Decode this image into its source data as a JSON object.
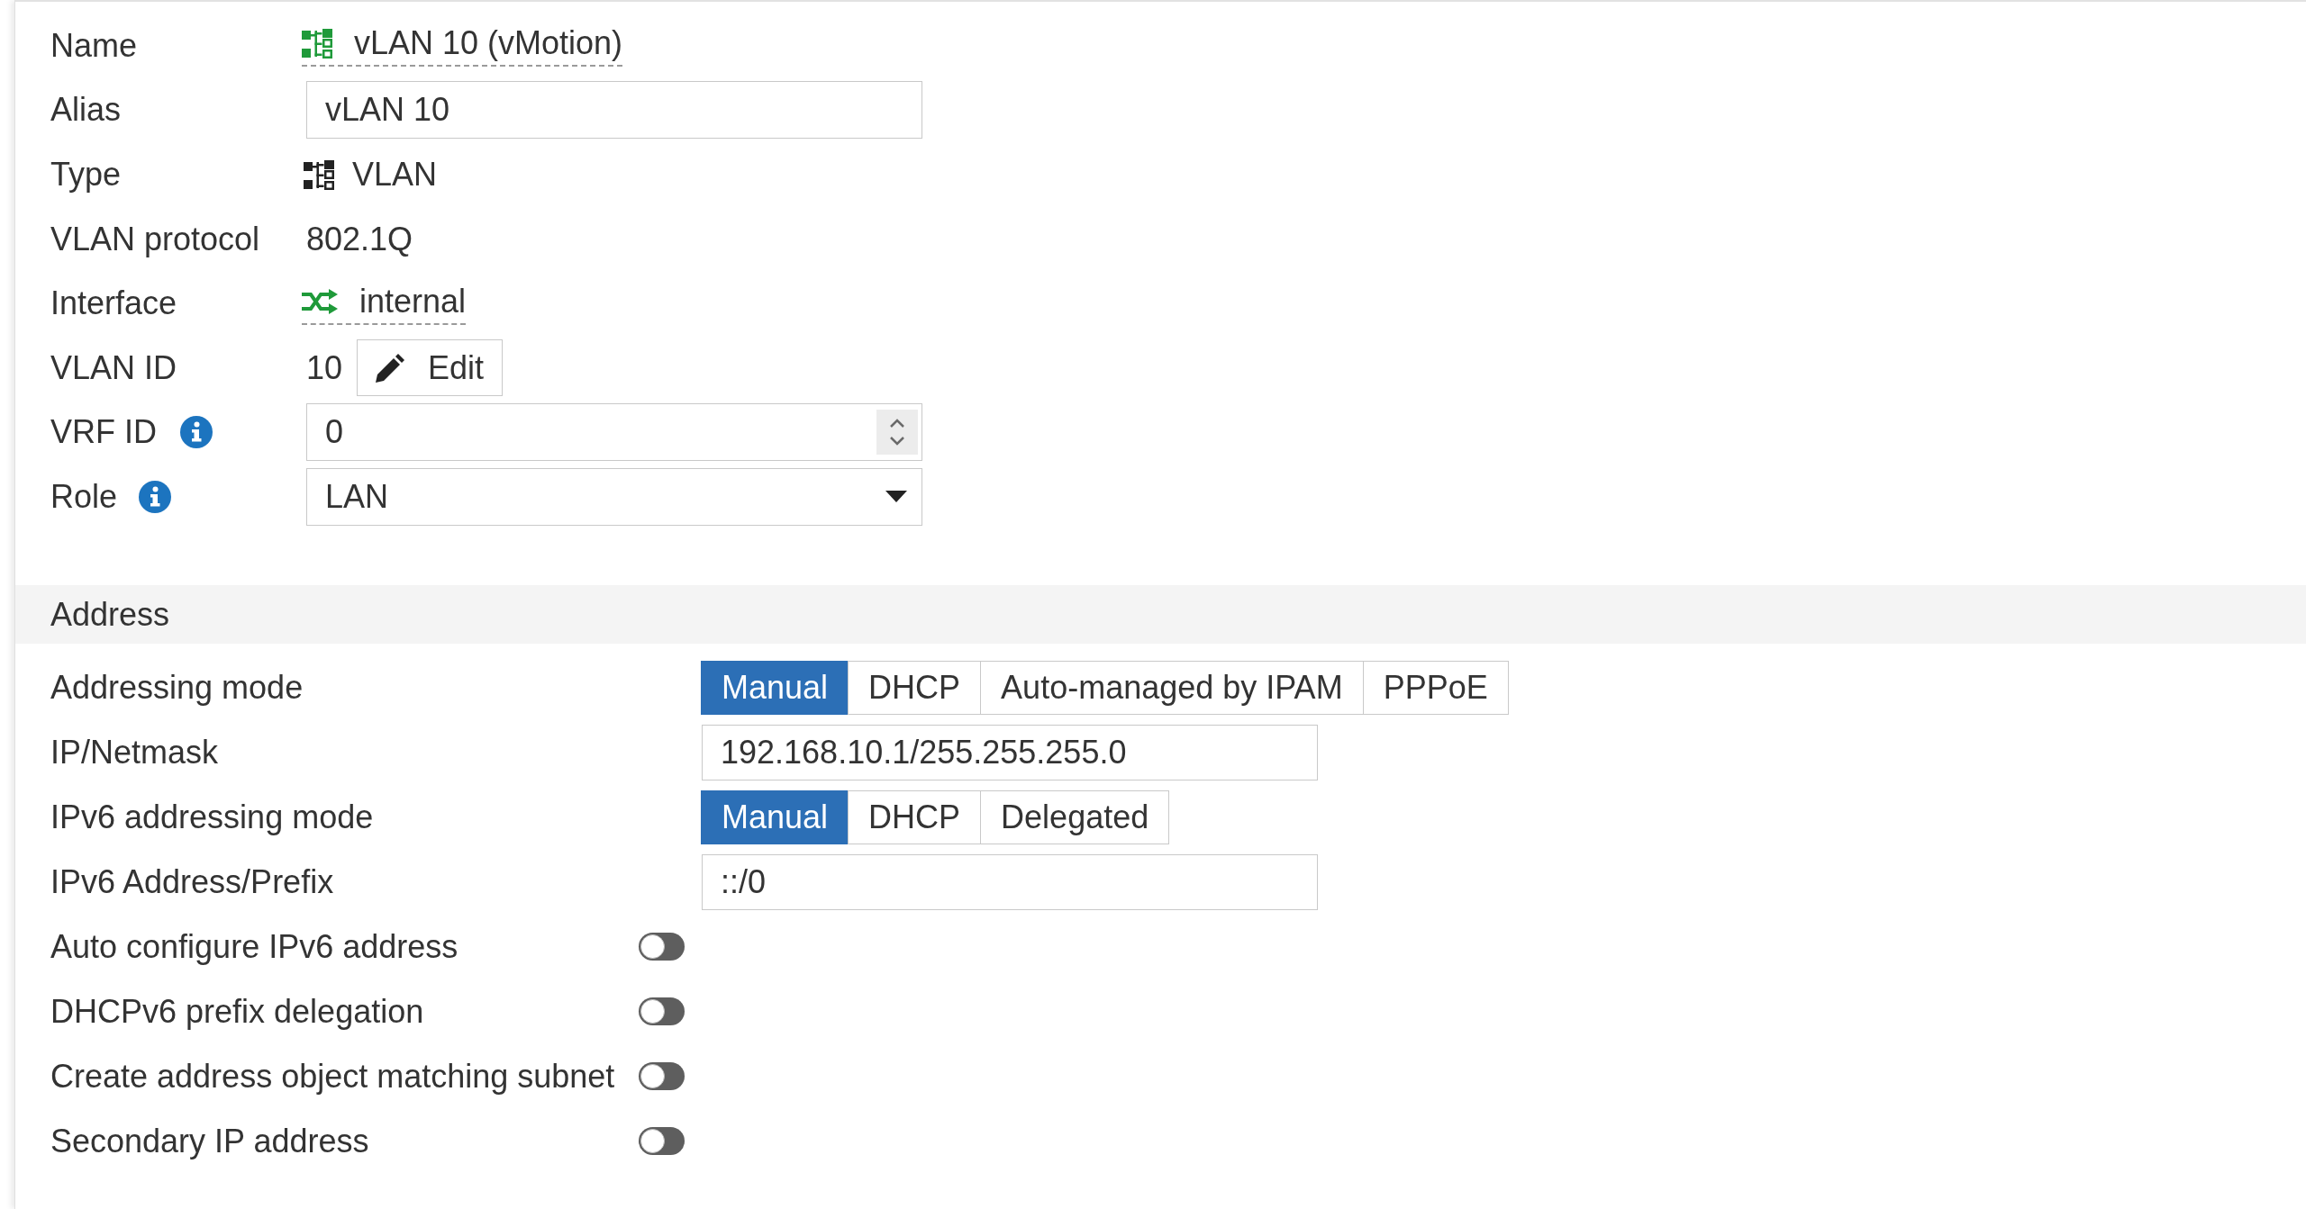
{
  "name": {
    "label": "Name",
    "value": "vLAN 10 (vMotion)"
  },
  "alias": {
    "label": "Alias",
    "value": "vLAN 10"
  },
  "type": {
    "label": "Type",
    "value": "VLAN"
  },
  "vlan_protocol": {
    "label": "VLAN protocol",
    "value": "802.1Q"
  },
  "interface": {
    "label": "Interface",
    "value": "internal"
  },
  "vlan_id": {
    "label": "VLAN ID",
    "value": "10",
    "button": "Edit"
  },
  "vrf_id": {
    "label": "VRF ID",
    "value": "0"
  },
  "role": {
    "label": "Role",
    "value": "LAN"
  },
  "address": {
    "title": "Address",
    "addressing_mode": {
      "label": "Addressing mode",
      "options": [
        {
          "label": "Manual",
          "selected": true
        },
        {
          "label": "DHCP",
          "selected": false
        },
        {
          "label": "Auto-managed by IPAM",
          "selected": false
        },
        {
          "label": "PPPoE",
          "selected": false
        }
      ]
    },
    "ip_netmask": {
      "label": "IP/Netmask",
      "value": "192.168.10.1/255.255.255.0"
    },
    "ipv6_addressing_mode": {
      "label": "IPv6 addressing mode",
      "options": [
        {
          "label": "Manual",
          "selected": true
        },
        {
          "label": "DHCP",
          "selected": false
        },
        {
          "label": "Delegated",
          "selected": false
        }
      ]
    },
    "ipv6_address_prefix": {
      "label": "IPv6 Address/Prefix",
      "value": "::/0"
    },
    "toggles": [
      {
        "label": "Auto configure IPv6 address",
        "on": false
      },
      {
        "label": "DHCPv6 prefix delegation",
        "on": false
      },
      {
        "label": "Create address object matching subnet",
        "on": false
      },
      {
        "label": "Secondary IP address",
        "on": false
      }
    ]
  }
}
